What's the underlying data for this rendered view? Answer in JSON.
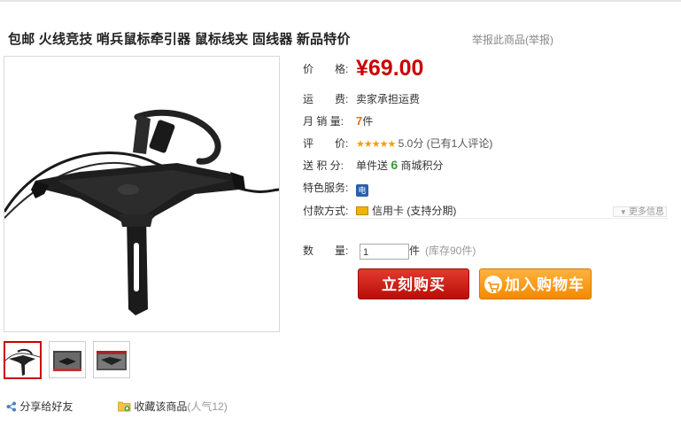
{
  "product": {
    "title": "包邮 火线竞技 哨兵鼠标牵引器 鼠标线夹 固线器 新品特价",
    "report_link": "举报此商品(举报)"
  },
  "details": {
    "price_label": "价　　格:",
    "price": "¥69.00",
    "shipping_label": "运　　费:",
    "shipping": "卖家承担运费",
    "sales_label": "月 销 量:",
    "sales_count": "7",
    "sales_unit": "件",
    "rating_label": "评　　价:",
    "rating_stars": "★★★★★",
    "rating_text": "5.0分 (已有1人评论)",
    "points_label": "送 积 分:",
    "points_prefix": "单件送",
    "points_value": "6",
    "points_suffix": "商城积分",
    "service_label": "特色服务:",
    "service_icon": "电",
    "payment_label": "付款方式:",
    "payment": "信用卡 (支持分期)",
    "more_info": "更多信息"
  },
  "purchase": {
    "qty_label": "数　　量:",
    "qty_value": "1",
    "qty_unit": "件",
    "stock": "(库存90件)",
    "buy_label": "立刻购买",
    "cart_label": "加入购物车"
  },
  "social": {
    "share_label": "分享给好友",
    "favorite_label": "收藏该商品",
    "popularity": "(人气12)"
  },
  "colors": {
    "price": "#cc0000",
    "buy_button": "#c9140d",
    "cart_button": "#f39800",
    "accent_orange": "#e86c00",
    "points_green": "#3a9a3a"
  }
}
